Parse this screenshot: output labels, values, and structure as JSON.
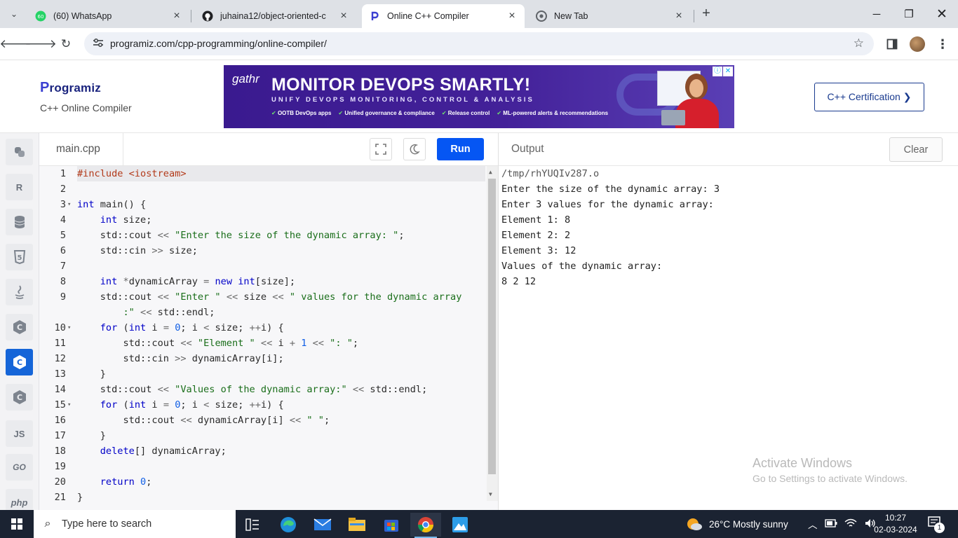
{
  "browser": {
    "tabs": [
      {
        "title": "(60) WhatsApp",
        "icon": "whatsapp-icon",
        "active": false
      },
      {
        "title": "juhaina12/object-oriented-c",
        "icon": "github-icon",
        "active": false
      },
      {
        "title": "Online C++ Compiler",
        "icon": "programiz-icon",
        "active": true
      },
      {
        "title": "New Tab",
        "icon": "chrome-icon",
        "active": false
      }
    ],
    "url": "programiz.com/cpp-programming/online-compiler/"
  },
  "site": {
    "logo": "rogramiz",
    "logo_initial": "P",
    "subtitle": "C++ Online Compiler",
    "cert_button": "C++ Certification ❯",
    "ad": {
      "brand": "gathr",
      "headline": "MONITOR DEVOPS SMARTLY!",
      "sub": "UNIFY DEVOPS MONITORING, CONTROL & ANALYSIS",
      "bullets": [
        "OOTB DevOps apps",
        "Unified governance & compliance",
        "Release control",
        "ML-powered alerts & recommendations"
      ]
    }
  },
  "rail": [
    {
      "label": "",
      "icon": "python-icon"
    },
    {
      "label": "R",
      "icon": "r-icon"
    },
    {
      "label": "",
      "icon": "database-icon"
    },
    {
      "label": "5",
      "icon": "html5-icon"
    },
    {
      "label": "",
      "icon": "java-icon"
    },
    {
      "label": "C",
      "icon": "c-icon"
    },
    {
      "label": "C",
      "icon": "cpp-icon",
      "active": true
    },
    {
      "label": "C",
      "icon": "csharp-icon"
    },
    {
      "label": "JS",
      "icon": "javascript-icon"
    },
    {
      "label": "GO",
      "icon": "go-icon"
    },
    {
      "label": "php",
      "icon": "php-icon"
    }
  ],
  "editor": {
    "file_name": "main.cpp",
    "run_label": "Run",
    "lines": [
      {
        "n": "1",
        "fold": "",
        "html": "<span class='inc'>#include &lt;iostream&gt;</span>"
      },
      {
        "n": "2",
        "fold": "",
        "html": ""
      },
      {
        "n": "3",
        "fold": "▾",
        "html": "<span class='k'>int</span> main() {"
      },
      {
        "n": "4",
        "fold": "",
        "html": "    <span class='k'>int</span> size;"
      },
      {
        "n": "5",
        "fold": "",
        "html": "    std::cout <span class='o'>&lt;&lt;</span> <span class='s'>\"Enter the size of the dynamic array: \"</span>;"
      },
      {
        "n": "6",
        "fold": "",
        "html": "    std::cin <span class='o'>&gt;&gt;</span> size;"
      },
      {
        "n": "7",
        "fold": "",
        "html": ""
      },
      {
        "n": "8",
        "fold": "",
        "html": "    <span class='k'>int</span> <span class='o'>*</span>dynamicArray <span class='o'>=</span> <span class='k'>new</span> <span class='k'>int</span>[size];"
      },
      {
        "n": "9",
        "fold": "",
        "html": "    std::cout <span class='o'>&lt;&lt;</span> <span class='s'>\"Enter \"</span> <span class='o'>&lt;&lt;</span> size <span class='o'>&lt;&lt;</span> <span class='s'>\" values for the dynamic array</span>"
      },
      {
        "n": "",
        "fold": "",
        "html": "        <span class='s'>:\"</span> <span class='o'>&lt;&lt;</span> std::endl;"
      },
      {
        "n": "10",
        "fold": "▾",
        "html": "    <span class='k'>for</span> (<span class='k'>int</span> i <span class='o'>=</span> <span class='n'>0</span>; i <span class='o'>&lt;</span> size; <span class='o'>++</span>i) {"
      },
      {
        "n": "11",
        "fold": "",
        "html": "        std::cout <span class='o'>&lt;&lt;</span> <span class='s'>\"Element \"</span> <span class='o'>&lt;&lt;</span> i <span class='o'>+</span> <span class='n'>1</span> <span class='o'>&lt;&lt;</span> <span class='s'>\": \"</span>;"
      },
      {
        "n": "12",
        "fold": "",
        "html": "        std::cin <span class='o'>&gt;&gt;</span> dynamicArray[i];"
      },
      {
        "n": "13",
        "fold": "",
        "html": "    }"
      },
      {
        "n": "14",
        "fold": "",
        "html": "    std::cout <span class='o'>&lt;&lt;</span> <span class='s'>\"Values of the dynamic array:\"</span> <span class='o'>&lt;&lt;</span> std::endl;"
      },
      {
        "n": "15",
        "fold": "▾",
        "html": "    <span class='k'>for</span> (<span class='k'>int</span> i <span class='o'>=</span> <span class='n'>0</span>; i <span class='o'>&lt;</span> size; <span class='o'>++</span>i) {"
      },
      {
        "n": "16",
        "fold": "",
        "html": "        std::cout <span class='o'>&lt;&lt;</span> dynamicArray[i] <span class='o'>&lt;&lt;</span> <span class='s'>\" \"</span>;"
      },
      {
        "n": "17",
        "fold": "",
        "html": "    }"
      },
      {
        "n": "18",
        "fold": "",
        "html": "    <span class='k'>delete</span>[] dynamicArray;"
      },
      {
        "n": "19",
        "fold": "",
        "html": ""
      },
      {
        "n": "20",
        "fold": "",
        "html": "    <span class='k'>return</span> <span class='n'>0</span>;"
      },
      {
        "n": "21",
        "fold": "",
        "html": "}"
      }
    ]
  },
  "output": {
    "title": "Output",
    "clear_label": "Clear",
    "lines": [
      "/tmp/rhYUQIv287.o",
      "Enter the size of the dynamic array: 3",
      "Enter 3 values for the dynamic array:",
      "Element 1: 8",
      "Element 2: 2",
      "Element 3: 12",
      "Values of the dynamic array:",
      "8 2 12"
    ]
  },
  "watermark": {
    "line1": "Activate Windows",
    "line2": "Go to Settings to activate Windows."
  },
  "taskbar": {
    "search_placeholder": "Type here to search",
    "weather": "26°C  Mostly sunny",
    "time": "10:27",
    "date": "02-03-2024",
    "notification_count": "1"
  }
}
